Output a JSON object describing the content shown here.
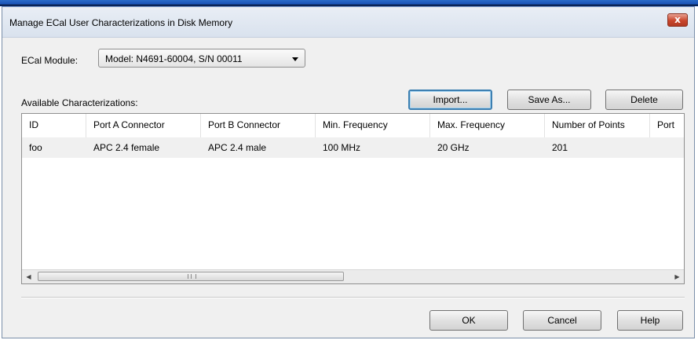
{
  "window": {
    "title": "Manage ECal User Characterizations in Disk Memory",
    "close_glyph": "x"
  },
  "module": {
    "label": "ECal Module:",
    "selected": "Model: N4691-60004, S/N 00011"
  },
  "available_label": "Available Characterizations:",
  "actions": {
    "import": "Import...",
    "save_as": "Save As...",
    "delete": "Delete"
  },
  "table": {
    "columns": [
      "ID",
      "Port A Connector",
      "Port B Connector",
      "Min. Frequency",
      "Max. Frequency",
      "Number of Points",
      "Port"
    ],
    "rows": [
      [
        "foo",
        "APC 2.4 female",
        "APC 2.4 male",
        "100 MHz",
        "20 GHz",
        "201",
        ""
      ]
    ]
  },
  "scroll": {
    "left_arrow": "◀",
    "right_arrow": "▶"
  },
  "footer": {
    "ok": "OK",
    "cancel": "Cancel",
    "help": "Help"
  },
  "colors": {
    "title_bar": "#dfe6f0",
    "close_button": "#c9462c",
    "focus_border": "#3c7fb1"
  }
}
